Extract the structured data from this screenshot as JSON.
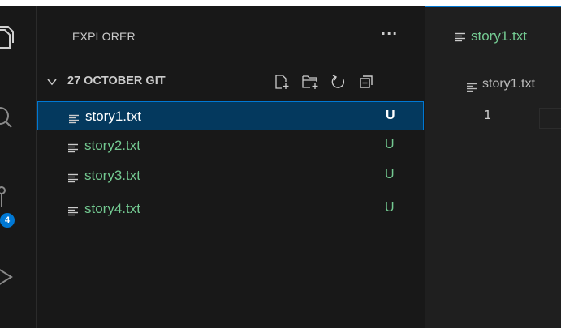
{
  "colors": {
    "background": "#181818",
    "editor_background": "#1f1f1f",
    "accent": "#0078d4",
    "untracked_green": "#73c991",
    "selected_background": "#04395e",
    "text": "#cccccc"
  },
  "activity_bar": {
    "icons": [
      "explorer-icon",
      "search-icon",
      "source-control-icon",
      "run-debug-icon"
    ],
    "source_control_badge": "4"
  },
  "sidebar": {
    "title": "EXPLORER",
    "more_actions": "···",
    "folder": {
      "name": "27 OCTOBER GIT",
      "expanded": true,
      "actions": [
        "new-file-icon",
        "new-folder-icon",
        "refresh-icon",
        "collapse-all-icon"
      ]
    },
    "files": [
      {
        "name": "story1.txt",
        "status": "U",
        "selected": true
      },
      {
        "name": "story2.txt",
        "status": "U",
        "selected": false
      },
      {
        "name": "story3.txt",
        "status": "U",
        "selected": false
      },
      {
        "name": "story4.txt",
        "status": "U",
        "selected": false
      }
    ]
  },
  "editor": {
    "tab_label": "story1.txt",
    "breadcrumb": "story1.txt",
    "line_number": "1"
  }
}
